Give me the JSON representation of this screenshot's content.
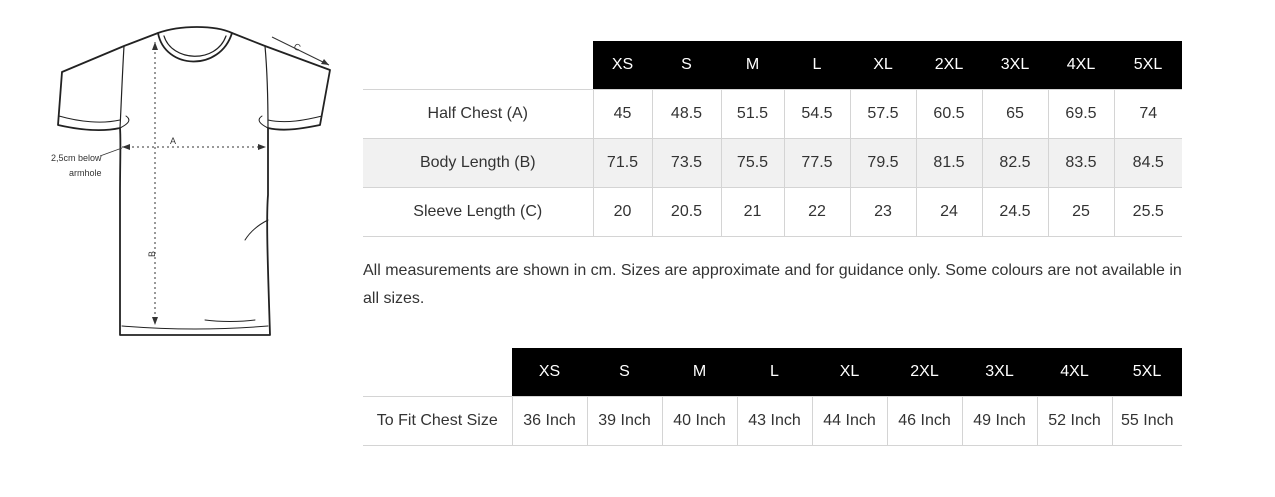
{
  "diagram": {
    "label_a": "A",
    "label_b": "B",
    "label_c": "C",
    "note_line1": "2,5cm below",
    "note_line2": "armhole"
  },
  "measurements_table": {
    "sizes": [
      "XS",
      "S",
      "M",
      "L",
      "XL",
      "2XL",
      "3XL",
      "4XL",
      "5XL"
    ],
    "rows": [
      {
        "label": "Half Chest (A)",
        "values": [
          "45",
          "48.5",
          "51.5",
          "54.5",
          "57.5",
          "60.5",
          "65",
          "69.5",
          "74"
        ]
      },
      {
        "label": "Body Length (B)",
        "values": [
          "71.5",
          "73.5",
          "75.5",
          "77.5",
          "79.5",
          "81.5",
          "82.5",
          "83.5",
          "84.5"
        ]
      },
      {
        "label": "Sleeve Length (C)",
        "values": [
          "20",
          "20.5",
          "21",
          "22",
          "23",
          "24",
          "24.5",
          "25",
          "25.5"
        ]
      }
    ]
  },
  "note": "All measurements are shown in cm. Sizes are approximate and for guidance only. Some colours are not available in all sizes.",
  "fit_table": {
    "sizes": [
      "XS",
      "S",
      "M",
      "L",
      "XL",
      "2XL",
      "3XL",
      "4XL",
      "5XL"
    ],
    "rows": [
      {
        "label": "To Fit Chest Size",
        "values": [
          "36 Inch",
          "39 Inch",
          "40 Inch",
          "43 Inch",
          "44 Inch",
          "46 Inch",
          "49 Inch",
          "52 Inch",
          "55 Inch"
        ]
      }
    ]
  }
}
